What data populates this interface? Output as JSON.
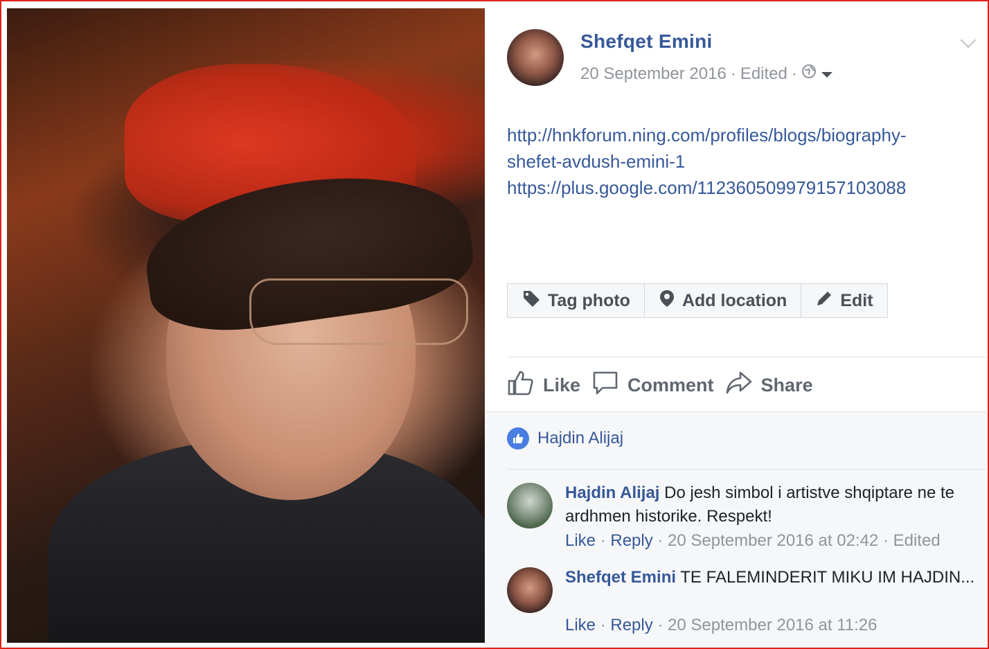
{
  "post": {
    "author": "Shefqet Emini",
    "date": "20 September 2016",
    "edited": "Edited",
    "privacy_icon": "globe-icon",
    "links": [
      "http://hnkforum.ning.com/profiles/blogs/biography-",
      "shefet-avdush-emini-1",
      "https://plus.google.com/112360509979157103088"
    ]
  },
  "photo_actions": {
    "tag": "Tag photo",
    "location": "Add location",
    "edit": "Edit"
  },
  "reactions": {
    "like": "Like",
    "comment": "Comment",
    "share": "Share"
  },
  "likes": {
    "names": "Hajdin Alijaj"
  },
  "comments": [
    {
      "author": "Hajdin Alijaj",
      "text": "Do jesh simbol i artistve shqiptare ne te ardhmen historike. Respekt!",
      "like": "Like",
      "reply": "Reply",
      "time": "20 September 2016 at 02:42",
      "edited": "Edited"
    },
    {
      "author": "Shefqet Emini",
      "text": "TE FALEMINDERIT MIKU IM HAJDIN...",
      "like": "Like",
      "reply": "Reply",
      "time": "20 September 2016 at 11:26"
    }
  ],
  "colors": {
    "link": "#365899",
    "frame": "#e0201b",
    "meta": "#90949c"
  }
}
